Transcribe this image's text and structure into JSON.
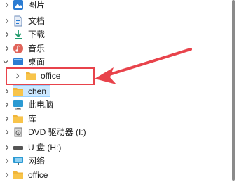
{
  "nav_tree": {
    "items": [
      {
        "label": "图片",
        "icon": "pictures-icon"
      },
      {
        "label": "文档",
        "icon": "documents-icon"
      },
      {
        "label": "下载",
        "icon": "downloads-icon"
      },
      {
        "label": "音乐",
        "icon": "music-icon"
      },
      {
        "label": "桌面",
        "icon": "desktop-icon",
        "expanded": true
      },
      {
        "label": "office",
        "icon": "folder-icon",
        "child": true
      },
      {
        "label": "chen",
        "icon": "folder-icon",
        "selected": true
      },
      {
        "label": "此电脑",
        "icon": "this-pc-icon"
      },
      {
        "label": "库",
        "icon": "library-icon"
      },
      {
        "label": "DVD 驱动器 (I:)",
        "icon": "dvd-drive-icon"
      },
      {
        "label": "U 盘 (H:)",
        "icon": "usb-drive-icon"
      },
      {
        "label": "网络",
        "icon": "network-icon"
      },
      {
        "label": "office",
        "icon": "folder-icon"
      }
    ]
  },
  "colors": {
    "selection_bg": "#cce8ff",
    "annotation_red": "#e8434b",
    "folder_yellow": "#f8c44a"
  }
}
